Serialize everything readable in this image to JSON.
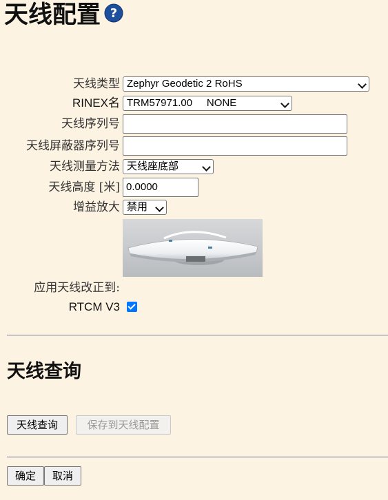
{
  "page": {
    "title": "天线配置"
  },
  "form": {
    "antenna_type": {
      "label": "天线类型",
      "value": "Zephyr Geodetic 2 RoHS"
    },
    "rinex_name": {
      "label": "RINEX名",
      "value": "TRM57971.00     NONE"
    },
    "serial": {
      "label": "天线序列号",
      "value": ""
    },
    "radome_serial": {
      "label": "天线屏蔽器序列号",
      "value": ""
    },
    "measure_method": {
      "label": "天线测量方法",
      "value": "天线座底部"
    },
    "height": {
      "label": "天线高度 [米]",
      "value": "0.0000"
    },
    "gain": {
      "label": "增益放大",
      "value": "禁用"
    },
    "apply_correction": {
      "label": "应用天线改正到:"
    },
    "rtcm": {
      "label": "RTCM V3",
      "checked": true
    }
  },
  "query": {
    "title": "天线查询",
    "query_button": "天线查询",
    "save_button": "保存到天线配置"
  },
  "footer": {
    "ok_button": "确定",
    "cancel_button": "取消"
  },
  "colors": {
    "background": "#fdf3e3",
    "accent": "#0075ff",
    "help_icon": "#1e4f9c"
  }
}
